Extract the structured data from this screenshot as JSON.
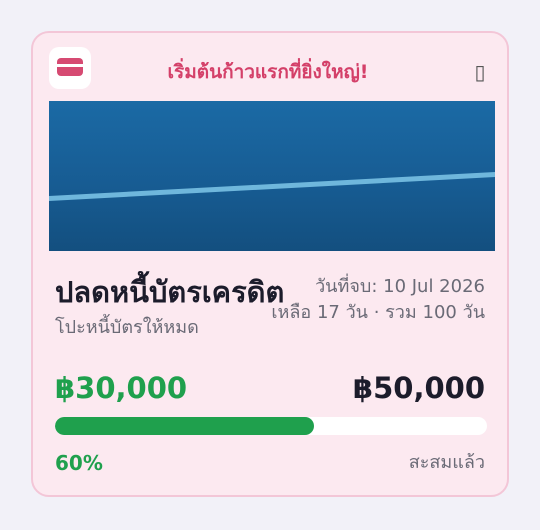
{
  "goal_card": {
    "icon": "credit-card-icon",
    "tagline": "เริ่มต้นก้าวแรกที่ยิ่งใหญ่!",
    "bookmark_icon": "bookmark-icon",
    "title": "ปลดหนี้บัตรเครดิต",
    "subtitle": "โปะหนี้บัตรให้หมด",
    "end_date": "วันที่จบ: 10 Jul 2026",
    "remaining": "เหลือ 17 วัน · รวม 100 วัน",
    "saved_amount": "฿30,000",
    "target_amount": "฿50,000",
    "progress_fraction": 0.6,
    "progress_label": "60%",
    "progress_caption": "สะสมแล้ว"
  },
  "colors": {
    "card_bg": "#fce9f0",
    "accent_pink": "#d44069",
    "progress_green": "#1fa04d",
    "banner_blue": "#1b6aa5"
  }
}
